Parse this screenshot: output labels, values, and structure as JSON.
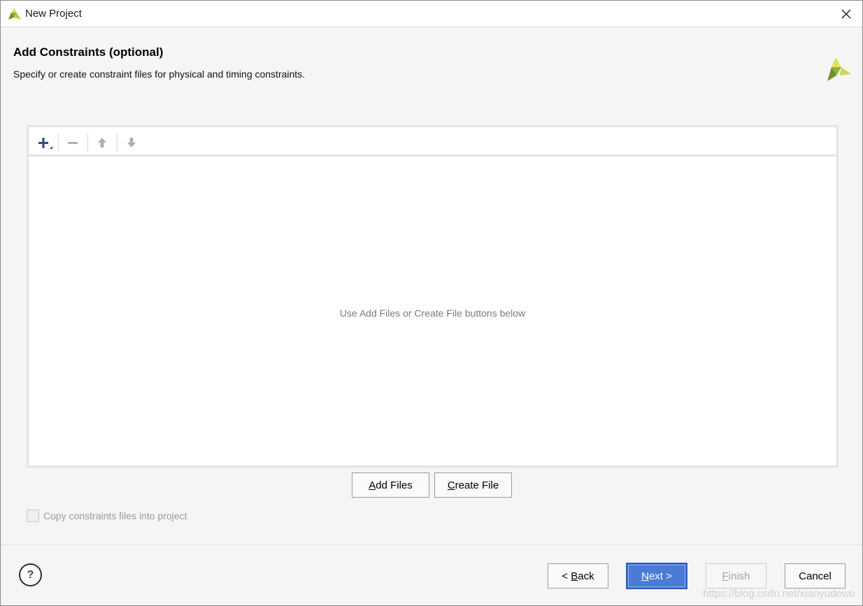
{
  "window": {
    "title": "New Project",
    "app_icon": "vivado-logo-icon",
    "close_icon": "close-icon"
  },
  "header": {
    "title": "Add Constraints (optional)",
    "subtitle": "Specify or create constraint files for physical and timing constraints.",
    "logo": "vivado-logo-icon"
  },
  "toolbar": {
    "items": [
      {
        "icon": "add-icon",
        "enabled": true
      },
      {
        "icon": "remove-icon",
        "enabled": false
      },
      {
        "icon": "move-up-icon",
        "enabled": false
      },
      {
        "icon": "move-down-icon",
        "enabled": false
      }
    ]
  },
  "file_list": {
    "empty_message": "Use Add Files or Create File buttons below"
  },
  "actions": {
    "add_files_prefix": "",
    "add_files_mnemonic": "A",
    "add_files_rest": "dd Files",
    "create_file_mnemonic": "C",
    "create_file_rest": "reate File"
  },
  "copy_option": {
    "label": "Copy constraints files into project",
    "checked": false,
    "enabled": false
  },
  "footer": {
    "help_label": "?",
    "back_prefix": "< ",
    "back_mnemonic": "B",
    "back_rest": "ack",
    "next_mnemonic": "N",
    "next_rest": "ext >",
    "finish_mnemonic": "F",
    "finish_rest": "inish",
    "cancel_label": "Cancel"
  },
  "watermark": "https://blog.csdn.net/xianyudewo",
  "colors": {
    "accent": "#4a7bd6",
    "logo_green": "#8db33a",
    "logo_yellow": "#e3e05a"
  }
}
